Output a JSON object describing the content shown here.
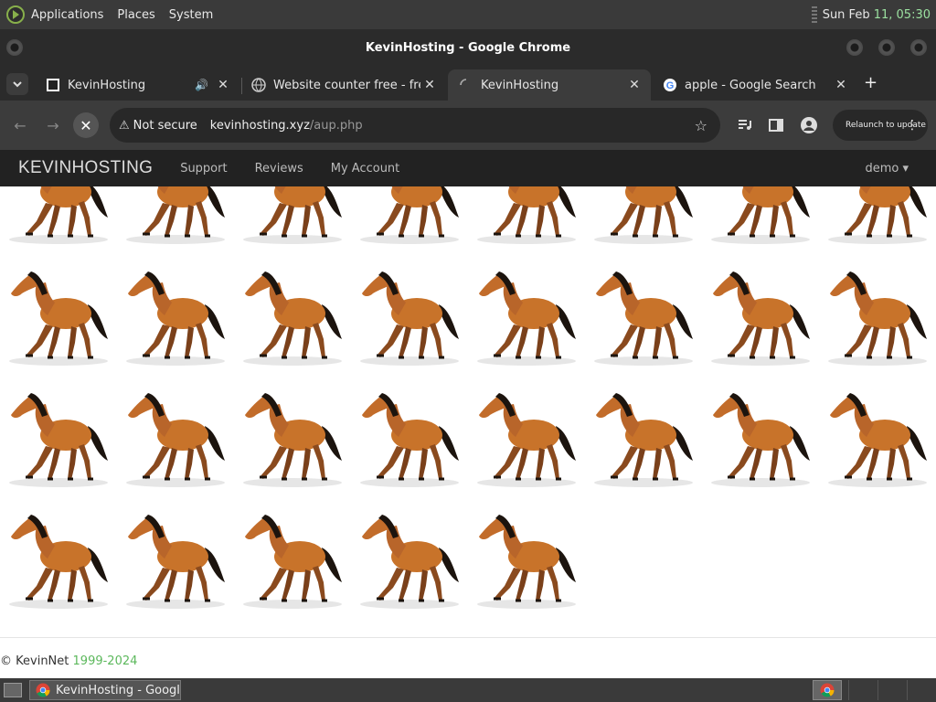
{
  "top_panel": {
    "menus": [
      "Applications",
      "Places",
      "System"
    ],
    "clock_date": "Sun Feb",
    "clock_time": "11, 05:30"
  },
  "window": {
    "title": "KevinHosting - Google Chrome"
  },
  "tabs": [
    {
      "label": "KevinHosting",
      "audio": "🔊"
    },
    {
      "label": "Website counter free - free"
    },
    {
      "label": "KevinHosting"
    },
    {
      "label": "apple - Google Search"
    }
  ],
  "toolbar": {
    "security": "Not secure",
    "url_host": "kevinhosting.xyz",
    "url_path": "/aup.php",
    "relaunch": "Relaunch to update"
  },
  "site": {
    "brand": "KEVINHOSTING",
    "nav": [
      "Support",
      "Reviews",
      "My Account"
    ],
    "user": "demo ▾",
    "horse_count": 29,
    "footer_owner": "KevinNet",
    "footer_years": "1999-2024"
  },
  "taskbar": {
    "task_label": "KevinHosting - Google..."
  },
  "colors": {
    "accent_green": "#5cb85c",
    "horse": "#c8732a"
  }
}
